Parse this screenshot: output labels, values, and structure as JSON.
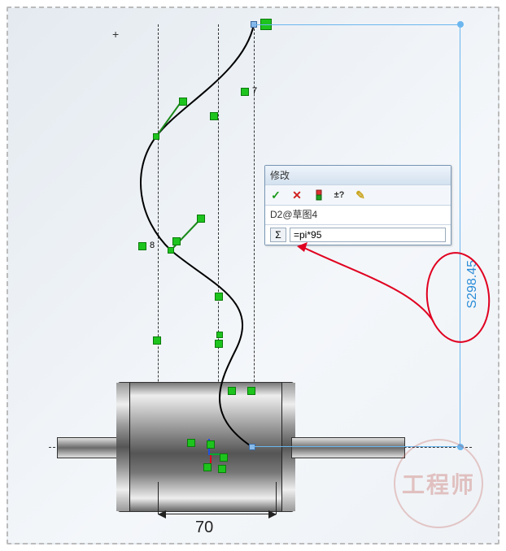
{
  "dialog": {
    "title": "修改",
    "link_label": "D2@草图4",
    "input_value": "=pi*95",
    "input_placeholder": "",
    "icons": {
      "ok": "✓",
      "cancel": "✕",
      "rebuild": "⟳",
      "toggle": "±?",
      "sketch": "✎"
    },
    "sigma": "Σ"
  },
  "dimensions": {
    "vertical": "S298.45",
    "horizontal": "70"
  },
  "sketch": {
    "labels": {
      "seven": "7",
      "eight": "8"
    }
  },
  "watermark": "工程师"
}
